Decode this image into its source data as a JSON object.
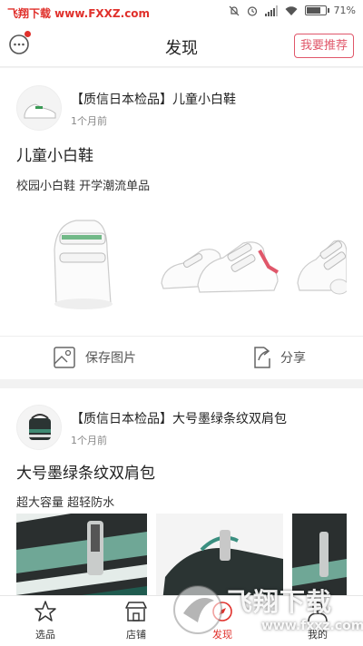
{
  "status_bar": {
    "watermark": "飞翔下载 www.FXXZ.com",
    "battery": "71%",
    "battery_level": 0.71,
    "icons": [
      "mute-icon",
      "alarm-icon",
      "signal-icon",
      "wifi-icon",
      "battery-icon"
    ]
  },
  "header": {
    "title": "发现",
    "recommend_button": "我要推荐"
  },
  "posts": [
    {
      "title": "【质信日本检品】儿童小白鞋",
      "time": "1个月前",
      "headline": "儿童小白鞋",
      "subline": "校园小白鞋 开学潮流单品"
    },
    {
      "title": "【质信日本检品】大号墨绿条纹双肩包",
      "time": "1个月前",
      "headline": "大号墨绿条纹双肩包",
      "subline": "超大容量 超轻防水"
    }
  ],
  "actions": {
    "save": "保存图片",
    "share": "分享"
  },
  "tabs": [
    {
      "label": "选品",
      "icon": "star-icon"
    },
    {
      "label": "店铺",
      "icon": "store-icon"
    },
    {
      "label": "发现",
      "icon": "discover-icon",
      "active": true
    },
    {
      "label": "我的",
      "icon": "user-icon"
    }
  ],
  "overlay_watermark": {
    "text": "飞翔下载",
    "url": "www.fxxz.com"
  },
  "colors": {
    "accent": "#e0302b",
    "recommend": "#e0576a",
    "bag_green": "#1f5b4f"
  }
}
